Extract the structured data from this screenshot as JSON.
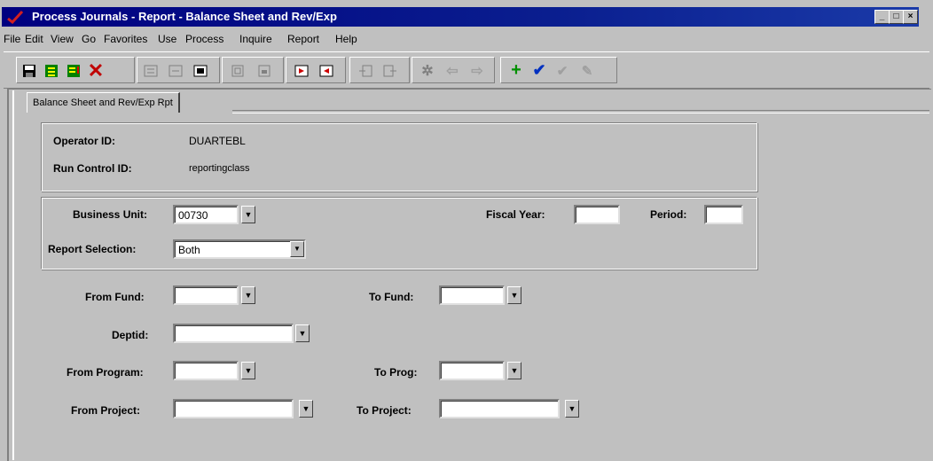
{
  "window": {
    "title": "Process Journals - Report - Balance Sheet and Rev/Exp",
    "controls": {
      "minimize": "_",
      "maximize": "□",
      "close": "×"
    }
  },
  "menu": [
    "File",
    "Edit",
    "View",
    "Go",
    "Favorites",
    "Use",
    "Process",
    "Inquire",
    "Report",
    "Help"
  ],
  "tab_label": "Balance Sheet and Rev/Exp Rpt",
  "header": {
    "operator_label": "Operator ID:",
    "operator_value": "DUARTEBL",
    "run_control_label": "Run Control ID:",
    "run_control_value": "reportingclass"
  },
  "params": {
    "business_unit_label": "Business Unit:",
    "business_unit_value": "00730",
    "fiscal_year_label": "Fiscal Year:",
    "fiscal_year_value": "",
    "period_label": "Period:",
    "period_value": "",
    "report_selection_label": "Report Selection:",
    "report_selection_value": "Both"
  },
  "filters": {
    "from_fund_label": "From Fund:",
    "to_fund_label": "To Fund:",
    "deptid_label": "Deptid:",
    "from_program_label": "From Program:",
    "to_prog_label": "To Prog:",
    "from_project_label": "From Project:",
    "to_project_label": "To Project:"
  },
  "icons": {
    "prompt": "down-arrow-prompt-icon",
    "dropdown": "dropdown-arrow-icon"
  },
  "colors": {
    "titlebar": "#000080",
    "face": "#c0c0c0"
  }
}
